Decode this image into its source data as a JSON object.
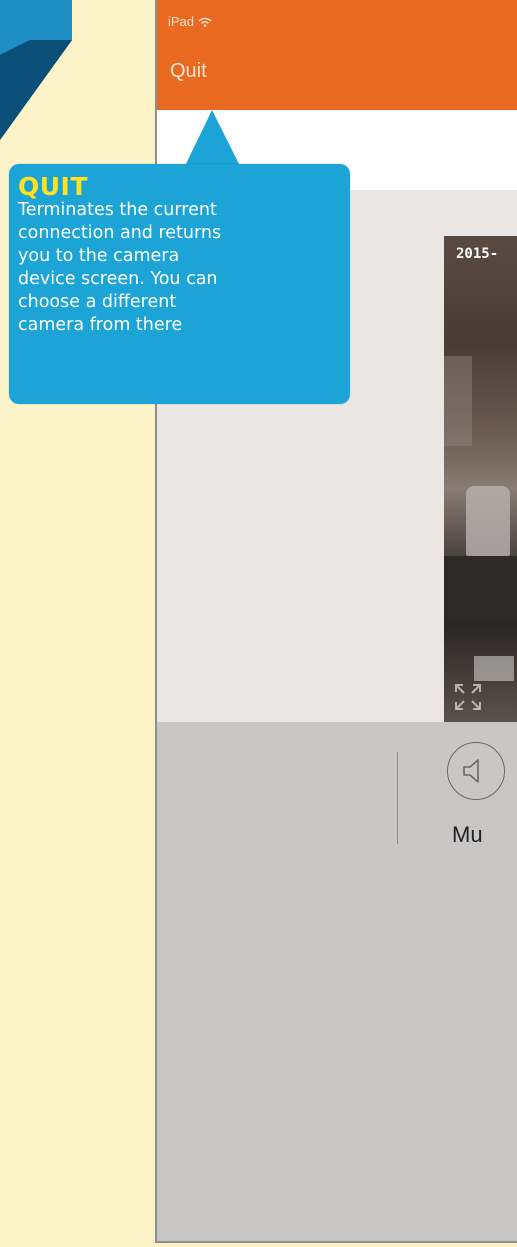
{
  "colors": {
    "page_background": "#fdf3c9",
    "nav_bar": "#e8691f",
    "callout_background": "#1da4d7",
    "callout_title": "#ffe21b"
  },
  "status_bar": {
    "device": "iPad",
    "wifi_icon": "wifi-icon"
  },
  "nav": {
    "quit_label": "Quit"
  },
  "camera": {
    "timestamp": "2015-",
    "fullscreen_icon": "fullscreen-icon"
  },
  "toolbar": {
    "mute_icon": "speaker-icon",
    "mute_label": "Mu"
  },
  "callout": {
    "title": "QUIT",
    "lines": [
      "Terminates the current",
      "connection and returns",
      "you to the camera",
      "device screen. You can",
      "choose a different",
      "camera from there"
    ]
  }
}
